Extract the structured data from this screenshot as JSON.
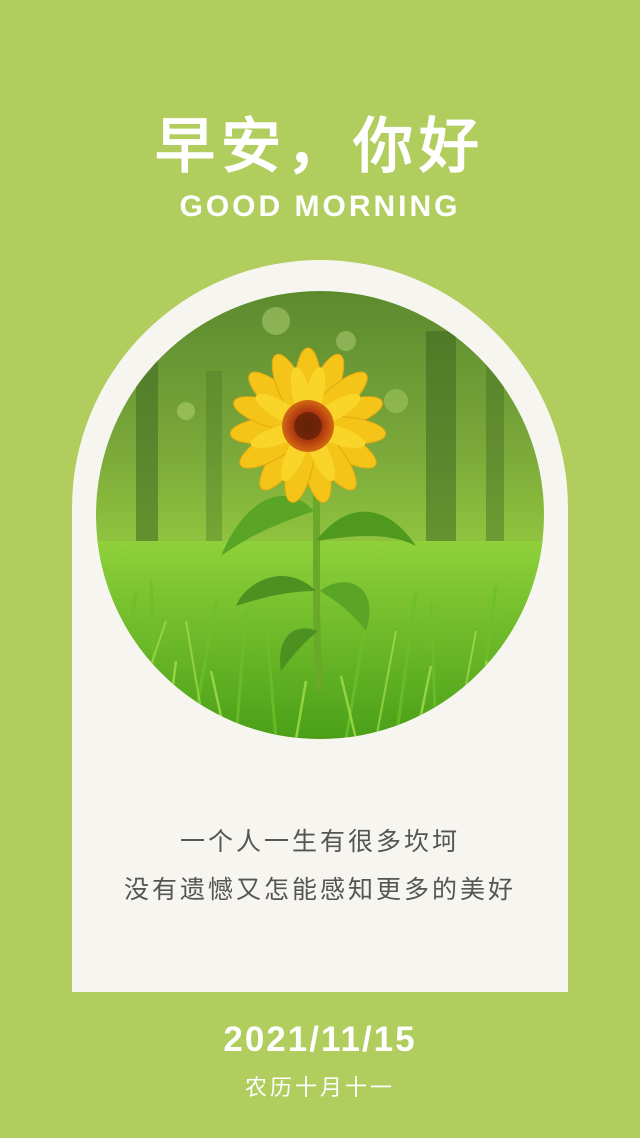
{
  "greeting": {
    "title": "早安，你好",
    "subtitle": "GOOD MORNING"
  },
  "image": {
    "subject": "sunflower-in-grass"
  },
  "quote": {
    "line1": "一个人一生有很多坎坷",
    "line2": "没有遗憾又怎能感知更多的美好"
  },
  "footer": {
    "date": "2021/11/15",
    "lunar_date": "农历十月十一"
  },
  "colors": {
    "background": "#b0cd5e",
    "card": "#f7f5ef",
    "text_light": "#ffffff",
    "text_dark": "#555555"
  }
}
